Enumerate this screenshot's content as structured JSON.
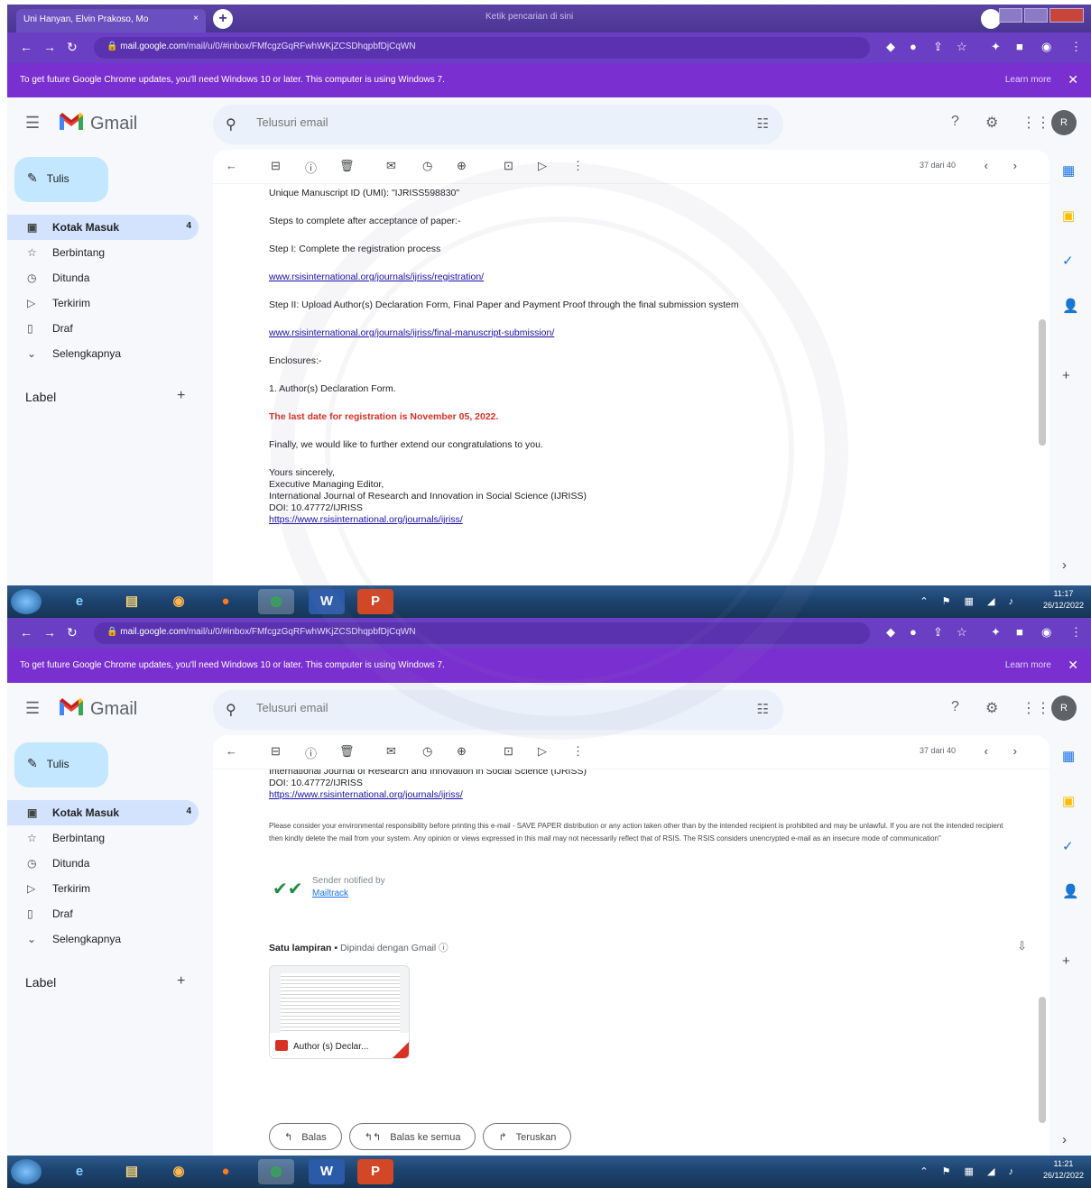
{
  "browser": {
    "tab_title": "Uni Hanyan, Elvin Prakoso, Mo",
    "tab_close": "×",
    "new_tab": "+",
    "window_title": "Ketik pencarian di sini",
    "url_host": "mail.google.com",
    "url_path": "/mail/u/0/#inbox/FMfcgzGqRFwhWKjZCSDhqpbfDjCqWN",
    "update_message": "To get future Google Chrome updates, you'll need Windows 10 or later. This computer is using Windows 7.",
    "learn_more": "Learn more",
    "update_close": "✕"
  },
  "gmail": {
    "app_name": "Gmail",
    "search_placeholder": "Telusuri email",
    "compose_label": "Tulis",
    "nav": [
      {
        "label": "Kotak Masuk",
        "icon": "inbox-icon",
        "count": "4"
      },
      {
        "label": "Berbintang",
        "icon": "star-icon"
      },
      {
        "label": "Ditunda",
        "icon": "clock-icon"
      },
      {
        "label": "Terkirim",
        "icon": "send-icon"
      },
      {
        "label": "Draf",
        "icon": "draft-icon"
      },
      {
        "label": "Selengkapnya",
        "icon": "chevron-down-icon"
      }
    ],
    "labels_title": "Label",
    "pager": "37 dari 40",
    "avatar_initial": "R"
  },
  "message1": {
    "umid_line": "Unique Manuscript ID (UMI):   \"IJRISS598830\"",
    "steps_heading": "Steps to complete after acceptance of paper:-",
    "step1": "Step I: Complete the registration process",
    "step1_link": "www.rsisinternational.org/journals/ijriss/registration/",
    "step2": "Step II: Upload Author(s) Declaration Form, Final Paper and Payment Proof through the final submission system",
    "step2_link": "www.rsisinternational.org/journals/ijriss/final-manuscript-submission/",
    "enclosures": "Enclosures:-",
    "enclosure_item": "1. Author(s) Declaration Form.",
    "deadline": "The last date for registration is November 05, 2022.",
    "congrats": "Finally, we would like to further extend our congratulations to you.",
    "sign_off": "Yours sincerely,",
    "sign_title": "Executive Managing Editor,",
    "sign_journal": "International Journal of Research and Innovation in Social Science (IJRISS)",
    "sign_doi": "DOI: 10.47772/IJRISS",
    "sign_link": "https://www.rsisinternational.org/journals/ijriss/"
  },
  "message2": {
    "journal_line": "International Journal of Research and Innovation in Social Science (IJRISS)",
    "doi": "DOI: 10.47772/IJRISS",
    "link": "https://www.rsisinternational.org/journals/ijriss/",
    "disclaimer": "Please consider your environmental responsibility before printing this e-mail - SAVE PAPER distribution or any action taken other than by the intended recipient is prohibited and may be unlawful. If you are not the intended recipient then kindly delete the mail from your system. Any opinion or views expressed in this mail may not necessarily reflect that of RSIS. The RSIS considers unencrypted e-mail as an insecure mode of communication\"",
    "mailtrack_1": "Sender notified by",
    "mailtrack_2": "Mailtrack",
    "attachments_title": "Satu lampiran",
    "attachments_sep": "•",
    "attachments_scanned": "Dipindai dengan Gmail",
    "attachment_name": "Author (s) Declar...",
    "reply": "Balas",
    "reply_all": "Balas ke semua",
    "forward": "Teruskan"
  },
  "taskbar": {
    "apps": [
      "start-orb",
      "ie-icon",
      "explorer-icon",
      "media-icon",
      "firefox-icon",
      "chrome-icon",
      "word-icon",
      "powerpoint-icon"
    ],
    "word_label": "W",
    "ppt_label": "P",
    "clock1_time": "11:17",
    "clock1_date": "26/12/2022",
    "clock2_time": "11:21",
    "clock2_date": "26/12/2022"
  }
}
